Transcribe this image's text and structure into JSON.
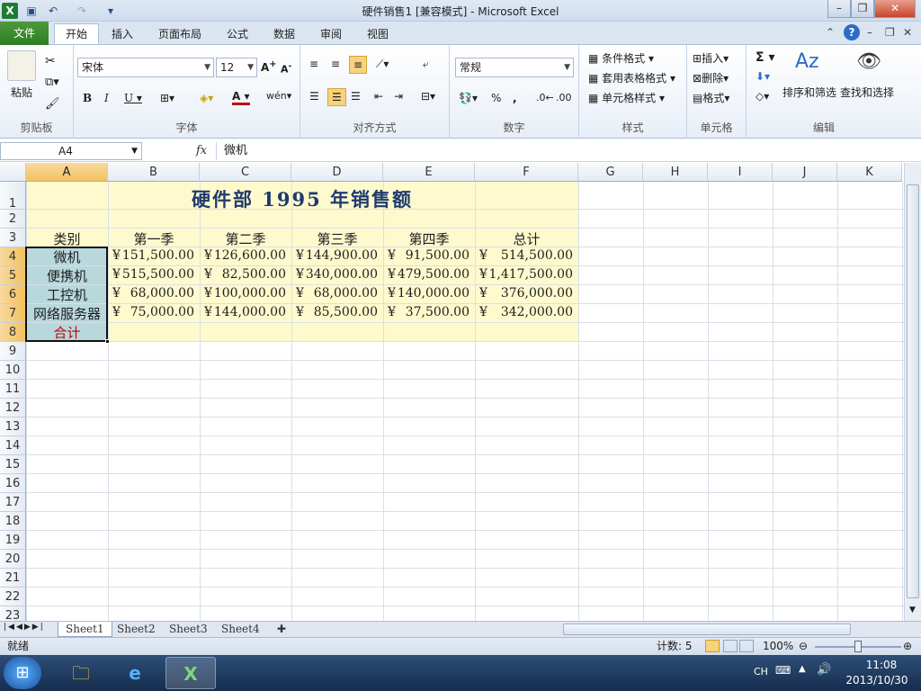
{
  "window": {
    "title": "硬件销售1 [兼容模式] - Microsoft Excel"
  },
  "tabs": [
    "文件",
    "开始",
    "插入",
    "页面布局",
    "公式",
    "数据",
    "审阅",
    "视图"
  ],
  "ribbon": {
    "clipboard": {
      "label": "剪贴板",
      "paste": "粘贴"
    },
    "font": {
      "label": "字体",
      "name": "宋体",
      "size": "12"
    },
    "alignment": {
      "label": "对齐方式"
    },
    "number": {
      "label": "数字",
      "format": "常规"
    },
    "styles": {
      "label": "样式",
      "conditional": "条件格式",
      "table": "套用表格格式",
      "cell_styles": "单元格样式"
    },
    "cells": {
      "label": "单元格",
      "insert": "插入",
      "delete": "删除",
      "format": "格式"
    },
    "editing": {
      "label": "编辑",
      "sort": "排序和筛选",
      "find": "查找和选择"
    }
  },
  "formula_bar": {
    "name_box": "A4",
    "fx": "fx",
    "content": "微机"
  },
  "columns": [
    "A",
    "B",
    "C",
    "D",
    "E",
    "F",
    "G",
    "H",
    "I",
    "J",
    "K"
  ],
  "rows": [
    "1",
    "2",
    "3",
    "4",
    "5",
    "6",
    "7",
    "8",
    "9",
    "10",
    "11",
    "12",
    "13",
    "14",
    "15",
    "16",
    "17",
    "18",
    "19",
    "20",
    "21",
    "22",
    "23"
  ],
  "sheet": {
    "title": "硬件部 1995 年销售额",
    "headers": [
      "类别",
      "第一季",
      "第二季",
      "第三季",
      "第四季",
      "总计"
    ],
    "currency": "¥",
    "data": [
      {
        "cat": "微机",
        "vals": [
          "151,500.00",
          "126,600.00",
          "144,900.00",
          "91,500.00",
          "514,500.00"
        ]
      },
      {
        "cat": "便携机",
        "vals": [
          "515,500.00",
          "82,500.00",
          "340,000.00",
          "479,500.00",
          "1,417,500.00"
        ]
      },
      {
        "cat": "工控机",
        "vals": [
          "68,000.00",
          "100,000.00",
          "68,000.00",
          "140,000.00",
          "376,000.00"
        ]
      },
      {
        "cat": "网络服务器",
        "vals": [
          "75,000.00",
          "144,000.00",
          "85,500.00",
          "37,500.00",
          "342,000.00"
        ]
      }
    ],
    "total_label": "合计"
  },
  "sheet_tabs": [
    "Sheet1",
    "Sheet2",
    "Sheet3",
    "Sheet4"
  ],
  "status": {
    "ready": "就绪",
    "count": "计数: 5",
    "zoom": "100%"
  },
  "taskbar": {
    "lang": "CH",
    "time": "11:08",
    "date": "2013/10/30"
  }
}
